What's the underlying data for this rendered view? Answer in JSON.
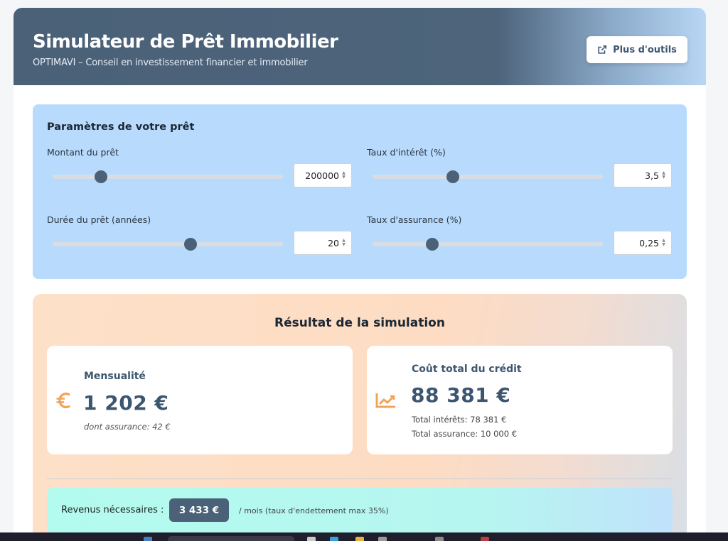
{
  "header": {
    "title": "Simulateur de Prêt Immobilier",
    "subtitle": "OPTIMAVI – Conseil en investissement financier et immobilier",
    "tools_button": "Plus d'outils",
    "tools_icon": "external-link-icon"
  },
  "params": {
    "title": "Paramètres de votre prêt",
    "fields": [
      {
        "label": "Montant du prêt",
        "value": "200000",
        "slider_fraction": 0.21
      },
      {
        "label": "Taux d'intérêt (%)",
        "value": "3,5",
        "slider_fraction": 0.35
      },
      {
        "label": "Durée du prêt (années)",
        "value": "20",
        "slider_fraction": 0.6
      },
      {
        "label": "Taux d'assurance (%)",
        "value": "0,25",
        "slider_fraction": 0.26
      }
    ]
  },
  "results": {
    "title": "Résultat de la simulation",
    "monthly": {
      "icon": "euro-icon",
      "title": "Mensualité",
      "value": "1 202 €",
      "note": "dont assurance: 42 €"
    },
    "total": {
      "icon": "chart-line-icon",
      "title": "Coût total du crédit",
      "value": "88 381 €",
      "interest": "Total intérêts: 78 381 €",
      "insurance": "Total assurance: 10 000 €"
    },
    "income": {
      "label": "Revenus nécessaires :",
      "value": "3 433 €",
      "note": "/ mois (taux d'endettement max 35%)"
    }
  },
  "colors": {
    "primary": "#4a6178",
    "params_bg": "#b8dbfd",
    "results_bg": "#fde0c8",
    "accent_icon": "#f0a45a",
    "income_bg": "#b3fbee"
  }
}
